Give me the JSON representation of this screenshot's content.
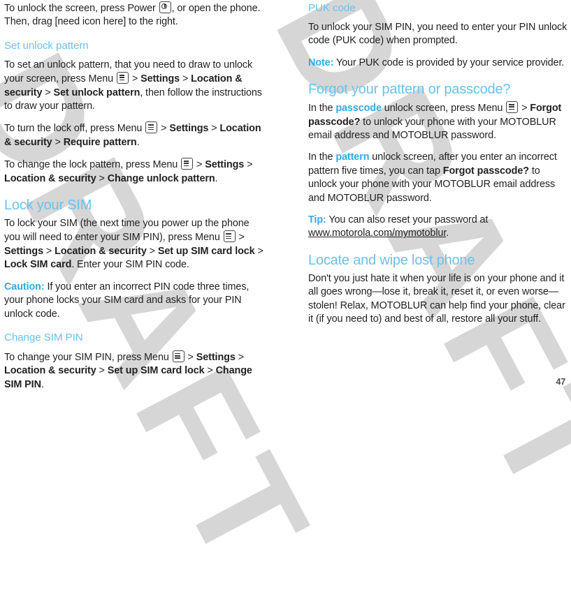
{
  "document": {
    "page_number": "47",
    "watermark": "DRAFT",
    "colors": {
      "heading_blue": "#68c2ef",
      "inline_blue": "#31a9e6",
      "body_text": "#231f20",
      "watermark_gray": "#d6d6d6"
    }
  },
  "icons": {
    "power": "power-icon",
    "menu": "menu-icon"
  },
  "left_column": {
    "para_intro": {
      "t1": "To unlock the screen, press Power ",
      "t2": ", or open the phone. Then, drag [need icon here] to the right."
    },
    "heading_set_unlock_pattern": "Set unlock pattern",
    "para_set_pattern": {
      "t1": "To set an unlock pattern, that you need to draw to unlock your screen, press Menu ",
      "t2": " > ",
      "b1": "Settings",
      "t3": " > ",
      "b2": "Location & security",
      "t4": " > ",
      "b3": "Set unlock pattern",
      "t5": ", then follow the instructions to draw your pattern."
    },
    "para_lock_off": {
      "t1": "To turn the lock off, press Menu ",
      "t2": " > ",
      "b1": "Settings",
      "t3": " > ",
      "b2": "Location & security",
      "t4": " > ",
      "b3": "Require pattern",
      "t5": "."
    },
    "para_change_pattern": {
      "t1": "To change the lock pattern, press Menu ",
      "t2": " > ",
      "b1": "Settings",
      "t3": " > ",
      "b2": "Location & security",
      "t4": " > ",
      "b3": "Change unlock pattern",
      "t5": "."
    },
    "heading_lock_your_sim": "Lock your SIM",
    "para_lock_sim": {
      "t1": "To lock your SIM (the next time you power up the phone you will need to enter your SIM PIN), press Menu ",
      "t2": " > ",
      "b1": "Settings",
      "t3": " > ",
      "b2": "Location & security",
      "t4": " > ",
      "b3": "Set up SIM card lock",
      "t5": " > ",
      "b4": "Lock SIM card",
      "t6": ". Enter your SIM PIN code."
    },
    "para_caution": {
      "label": "Caution:",
      "text": " If you enter an incorrect PIN code three times, your phone locks your SIM card and asks for your PIN unlock code."
    },
    "heading_change_sim_pin": "Change SIM PIN",
    "para_change_sim_pin": {
      "t1": "To change your SIM PIN, press Menu ",
      "t2": " > ",
      "b1": "Settings",
      "t3": " > ",
      "b2": "Location & security",
      "t4": " > ",
      "b3": "Set up SIM card lock",
      "t5": " > ",
      "b4": "Change SIM PIN",
      "t6": "."
    }
  },
  "right_column": {
    "heading_puk_code": "PUK code",
    "para_puk": "To unlock your SIM PIN, you need to enter your PIN unlock code (PUK code) when prompted.",
    "para_note": {
      "label": "Note:",
      "text": " Your PUK code is provided by your service provider."
    },
    "heading_forgot": "Forgot your pattern or passcode?",
    "para_passcode_screen": {
      "t1": "In the ",
      "blue1": "passcode",
      "t2": " unlock screen, press Menu ",
      "t3": " > ",
      "b1": "Forgot passcode?",
      "t4": " to unlock your phone with your MOTOBLUR email address and MOTOBLUR password."
    },
    "para_pattern_screen": {
      "t1": "In the ",
      "blue1": "pattern",
      "t2": " unlock screen, after you enter an incorrect pattern five times, you can tap ",
      "b1": "Forgot passcode?",
      "t3": " to unlock your phone with your MOTOBLUR email address and MOTOBLUR password."
    },
    "para_tip": {
      "label": "Tip:",
      "text": " You can also reset your password at ",
      "url": "www.motorola.com/mymotoblur",
      "tail": "."
    },
    "heading_locate_wipe": "Locate and wipe lost phone",
    "para_locate": "Don't you just hate it when your life is on your phone and it all goes wrong—lose it, break it, reset it, or even worse—stolen! Relax, MOTOBLUR can help find your phone, clear it (if you need to) and best of all, restore all your stuff."
  }
}
